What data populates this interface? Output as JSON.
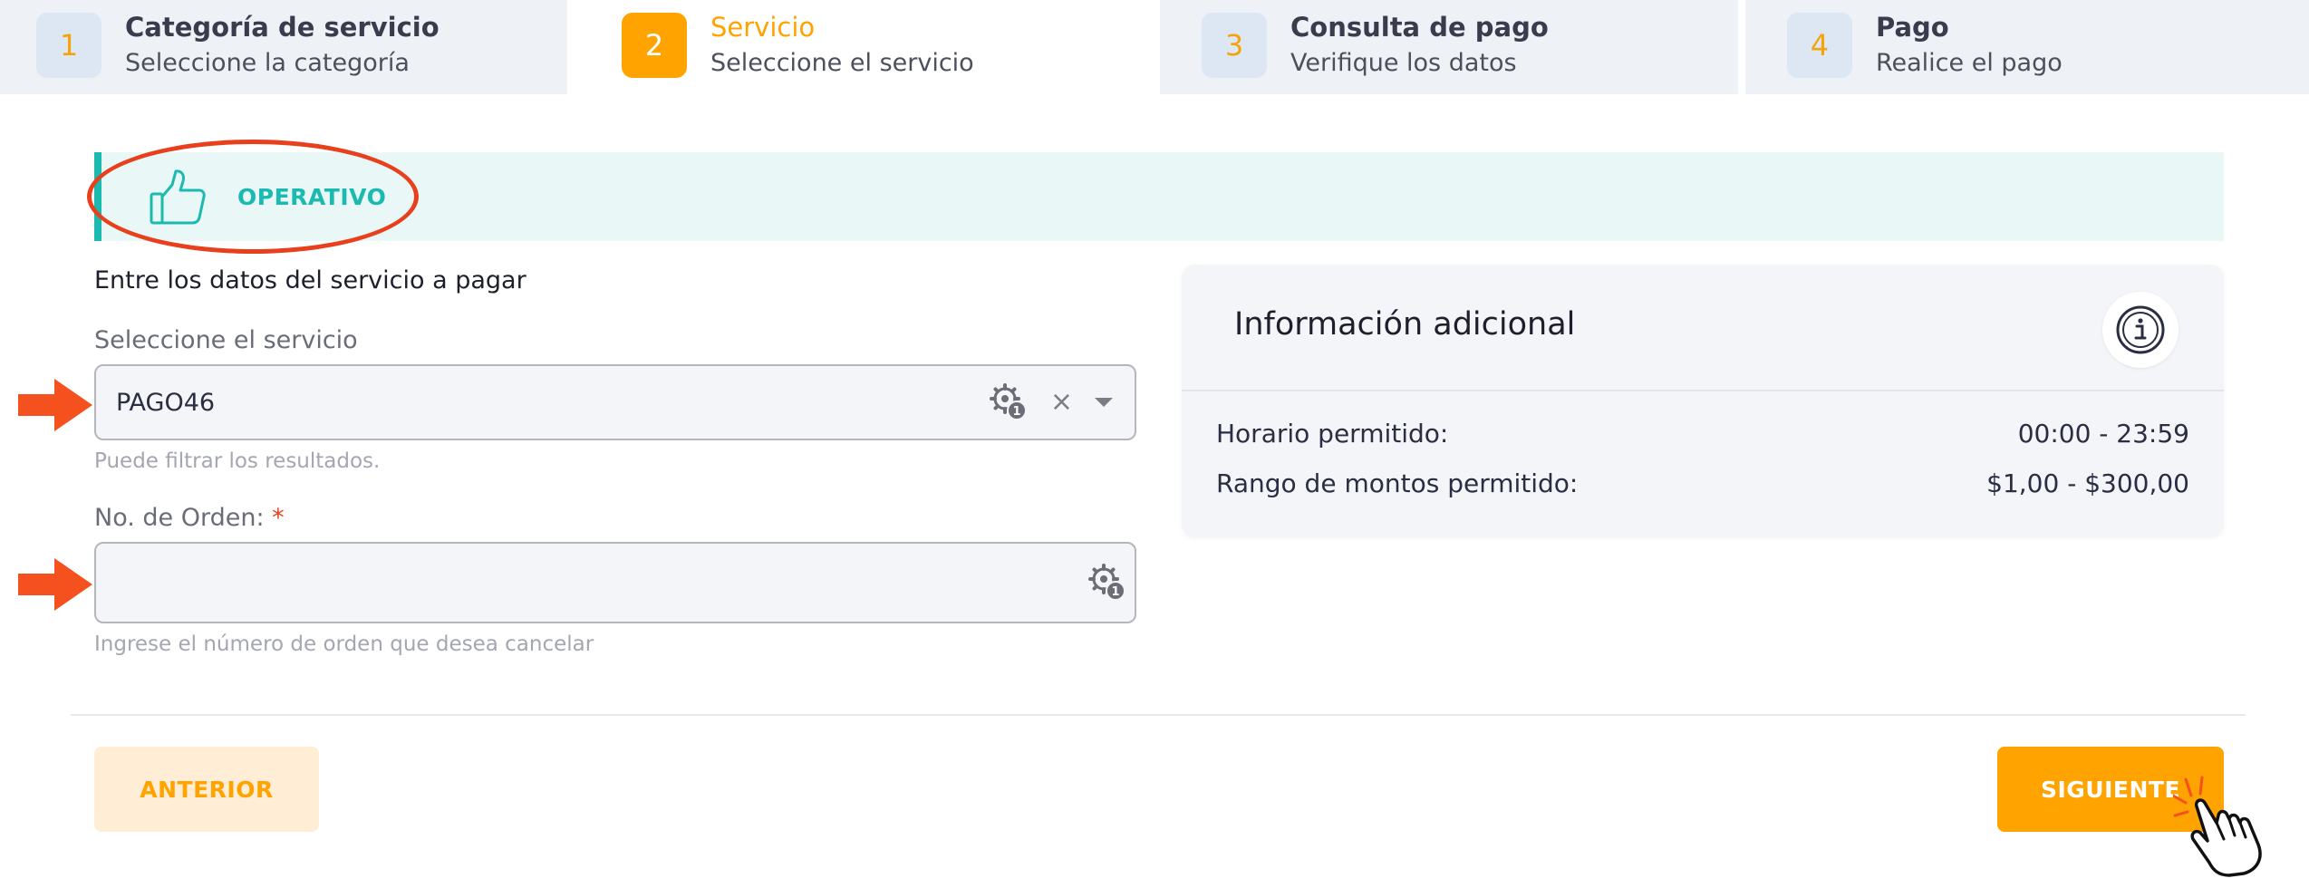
{
  "stepper": {
    "steps": [
      {
        "number": "1",
        "title": "Categoría de servicio",
        "subtitle": "Seleccione la categoría"
      },
      {
        "number": "2",
        "title": "Servicio",
        "subtitle": "Seleccione el servicio"
      },
      {
        "number": "3",
        "title": "Consulta de pago",
        "subtitle": "Verifique los datos"
      },
      {
        "number": "4",
        "title": "Pago",
        "subtitle": "Realice el pago"
      }
    ],
    "active_step": 2
  },
  "status": {
    "label": "OPERATIVO",
    "icon": "thumbs-up-icon",
    "color": "#1bbab0"
  },
  "form": {
    "heading": "Entre los datos del servicio a pagar",
    "service": {
      "label": "Seleccione el servicio",
      "value": "PAGO46",
      "helper": "Puede filtrar los resultados.",
      "clear_symbol": "×"
    },
    "order": {
      "label": "No. de Orden:",
      "required_mark": "*",
      "value": "",
      "placeholder": "",
      "helper": "Ingrese el número de orden que desea cancelar"
    }
  },
  "info": {
    "title": "Información adicional",
    "rows": [
      {
        "label": "Horario permitido:",
        "value": "00:00 - 23:59"
      },
      {
        "label": "Rango de montos permitido:",
        "value": "$1,00 - $300,00"
      }
    ]
  },
  "footer": {
    "prev_label": "ANTERIOR",
    "next_label": "SIGUIENTE"
  },
  "theme": {
    "accent": "#ffa300",
    "annotation": "#e8401c"
  }
}
